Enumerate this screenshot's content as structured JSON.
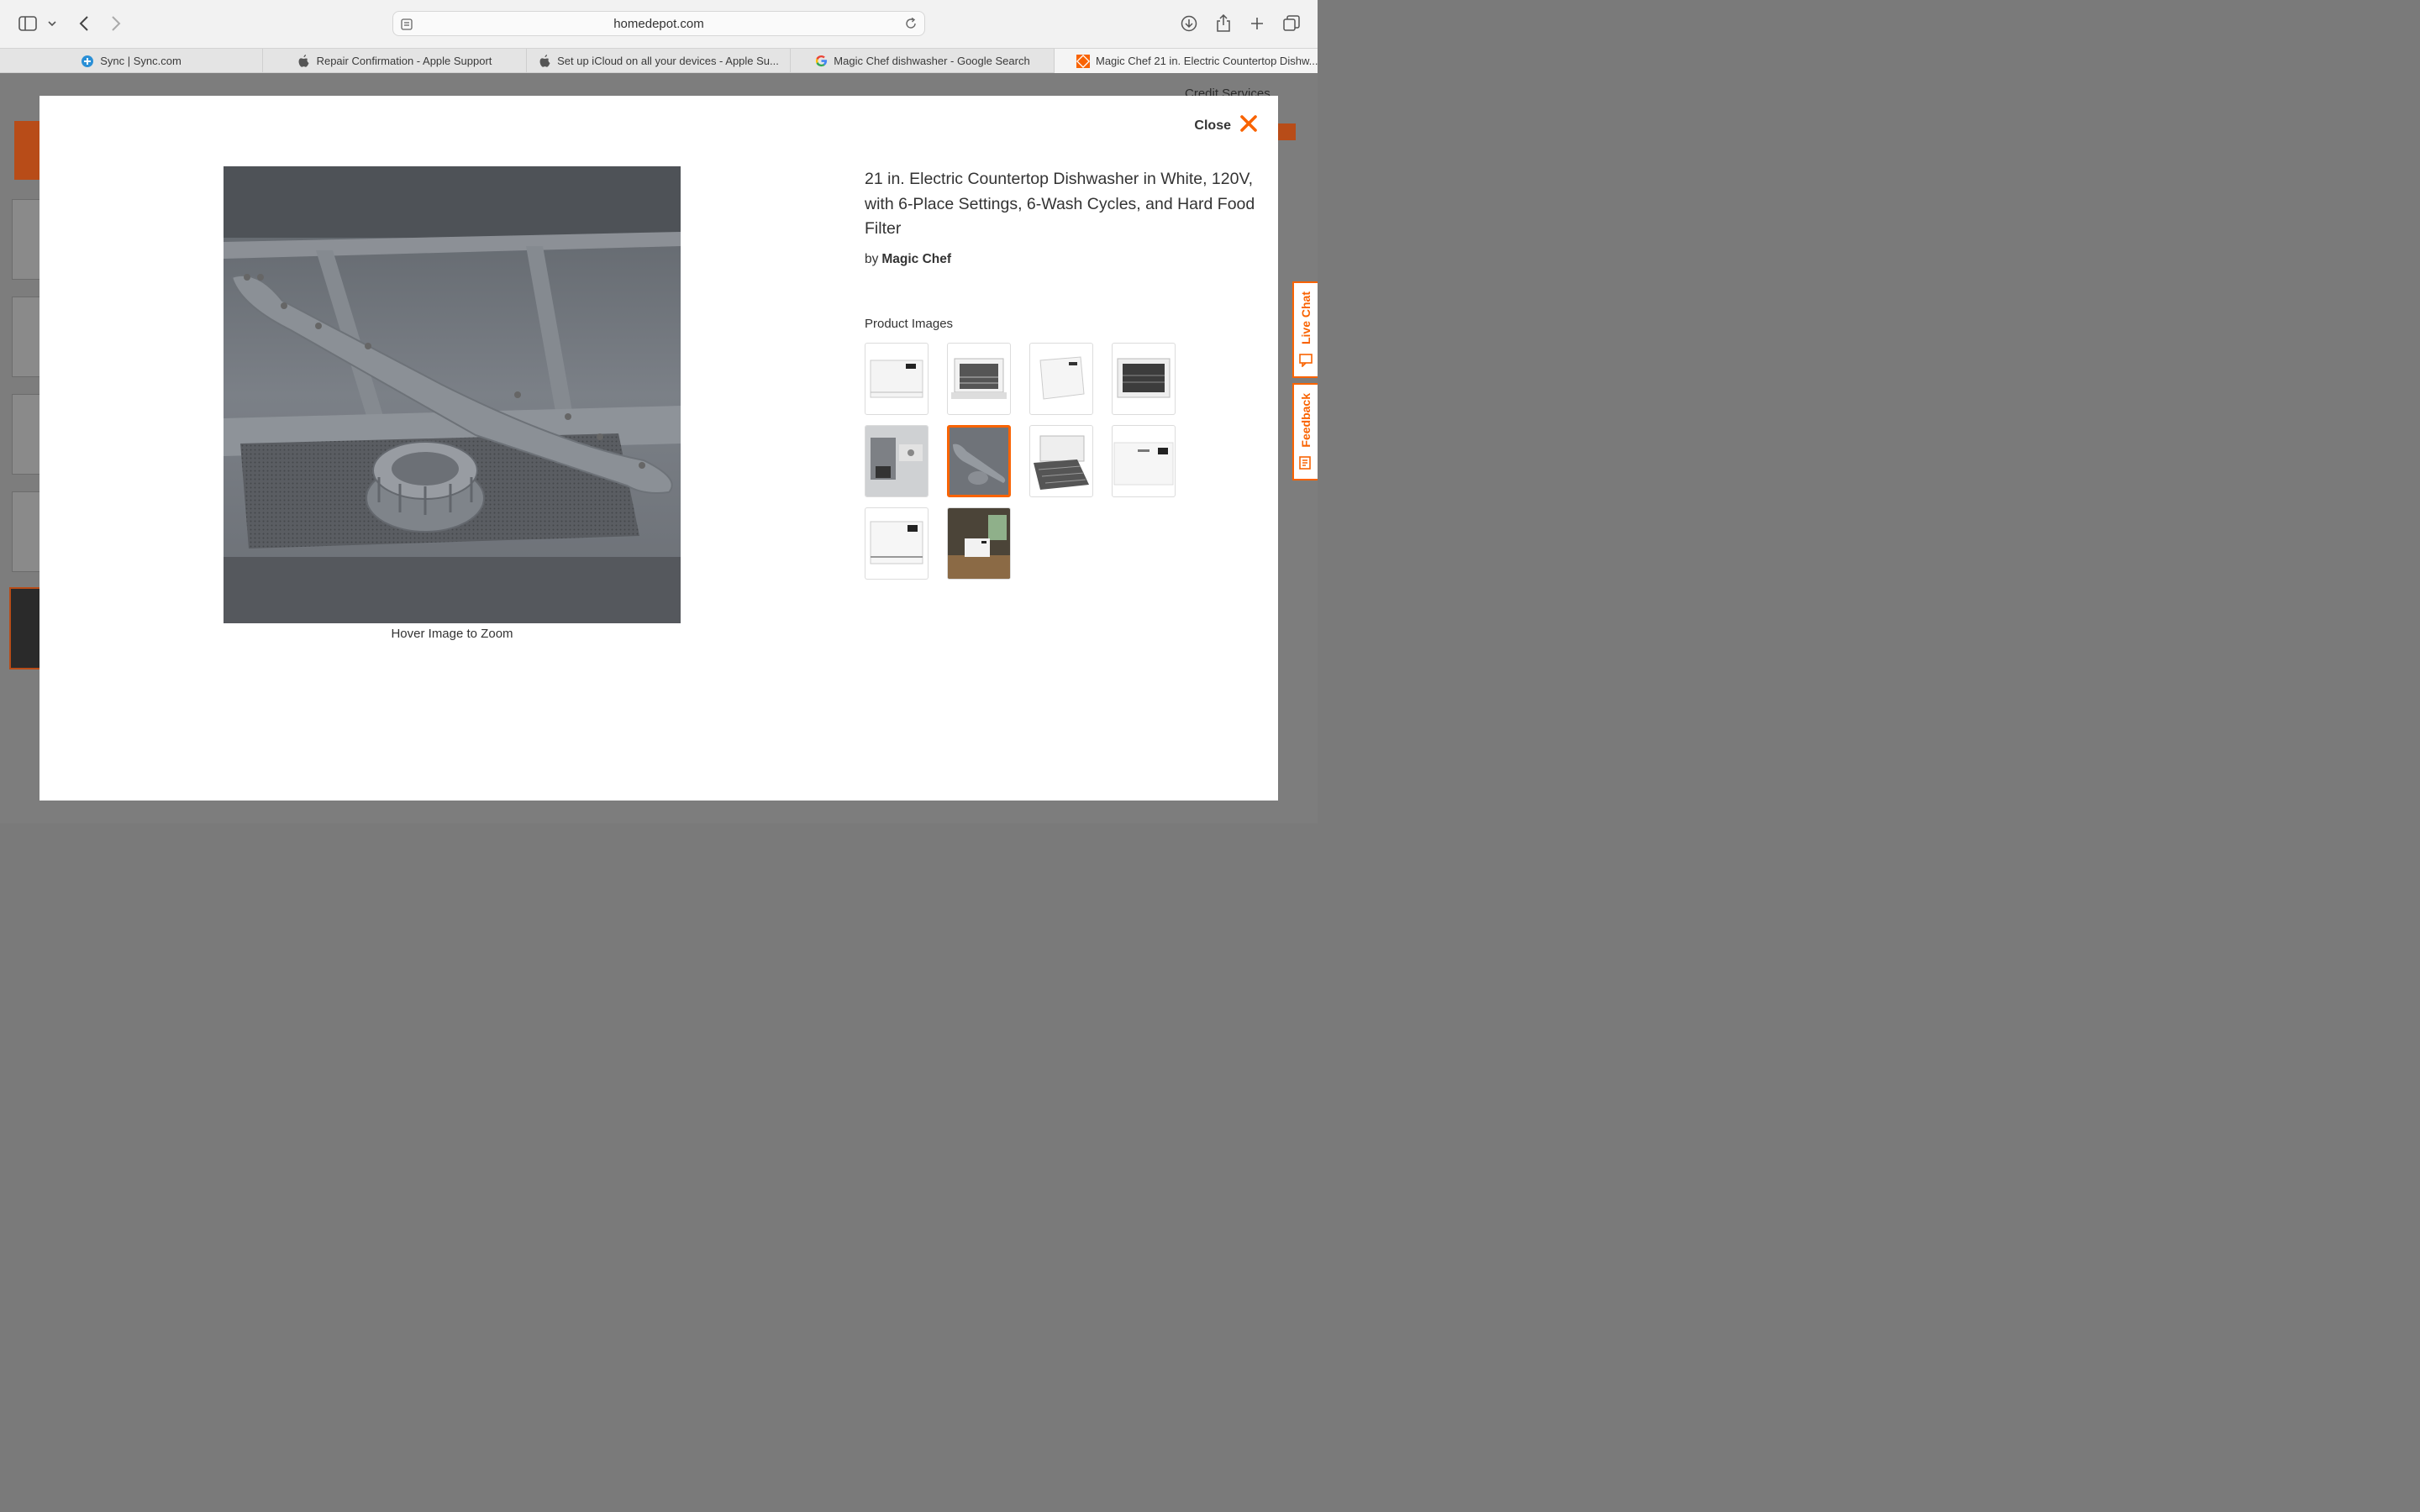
{
  "browser": {
    "url": "homedepot.com",
    "tabs": [
      {
        "label": "Sync | Sync.com",
        "icon": "sync-logo-icon"
      },
      {
        "label": "Repair Confirmation - Apple Support",
        "icon": "apple-logo-icon"
      },
      {
        "label": "Set up iCloud on all your devices - Apple Su...",
        "icon": "apple-logo-icon"
      },
      {
        "label": "Magic Chef dishwasher - Google Search",
        "icon": "google-logo-icon"
      },
      {
        "label": "Magic Chef 21 in. Electric Countertop Dishw...",
        "icon": "home-depot-logo-icon"
      }
    ]
  },
  "background_page": {
    "credit_services": "Credit Services"
  },
  "modal": {
    "close_label": "Close",
    "product_title": "21 in. Electric Countertop Dishwasher in White, 120V, with 6-Place Settings, 6-Wash Cycles, and Hard Food Filter",
    "by_label": "by",
    "brand": "Magic Chef",
    "caption": "Hover Image to Zoom",
    "product_images_heading": "Product Images",
    "thumbnails": [
      {
        "name": "front-closed",
        "selected": false
      },
      {
        "name": "front-open-racks",
        "selected": false
      },
      {
        "name": "angle-closed",
        "selected": false
      },
      {
        "name": "front-open-dark",
        "selected": false
      },
      {
        "name": "control-panel",
        "selected": false
      },
      {
        "name": "spray-arm",
        "selected": true
      },
      {
        "name": "open-rack-pulled",
        "selected": false
      },
      {
        "name": "front-panel-white",
        "selected": false
      },
      {
        "name": "front-closed-2",
        "selected": false
      },
      {
        "name": "kitchen-lifestyle",
        "selected": false
      }
    ]
  },
  "side_widgets": {
    "live_chat": "Live Chat",
    "feedback": "Feedback"
  },
  "colors": {
    "accent": "#f96302",
    "modal_bg": "#ffffff",
    "overlay": "#7d7d7d"
  }
}
